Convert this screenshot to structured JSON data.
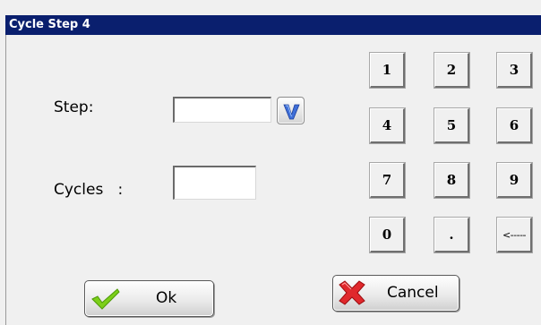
{
  "window": {
    "title": "Cycle Step 4"
  },
  "form": {
    "step_label": "Step:",
    "step_value": "",
    "cycles_label": "Cycles   :",
    "cycles_value": ""
  },
  "keypad": {
    "keys": [
      "1",
      "2",
      "3",
      "4",
      "5",
      "6",
      "7",
      "8",
      "9",
      "0",
      ".",
      "<-----"
    ]
  },
  "buttons": {
    "ok_label": "Ok",
    "cancel_label": "Cancel"
  },
  "icons": {
    "dropdown": "v-dropdown-icon",
    "ok": "checkmark-icon",
    "cancel": "red-x-icon"
  },
  "colors": {
    "titlebar": "#0a1f6e",
    "ok_check": "#7ccf1a",
    "cancel_x": "#e0282c"
  }
}
